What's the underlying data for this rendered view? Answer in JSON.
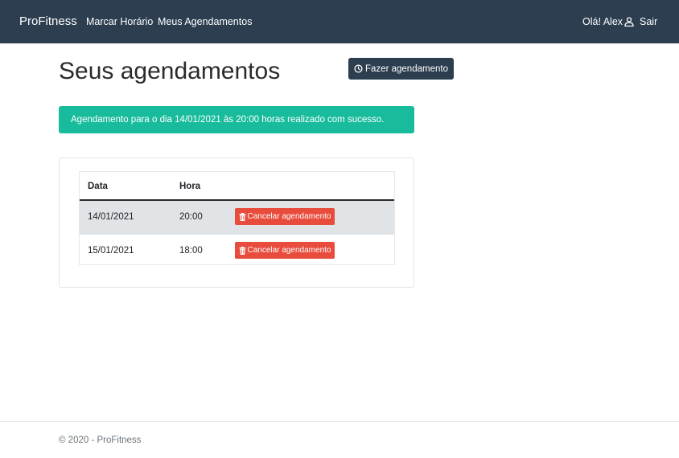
{
  "navbar": {
    "brand": "ProFitness",
    "links": [
      "Marcar Horário",
      "Meus Agendamentos"
    ],
    "greeting": "Olá! Alex",
    "logout": "Sair"
  },
  "main": {
    "title": "Seus agendamentos",
    "new_button": "Fazer agendamento",
    "alert": "Agendamento para o dia 14/01/2021 às 20:00 horas realizado com sucesso."
  },
  "table": {
    "headers": [
      "Data",
      "Hora"
    ],
    "rows": [
      {
        "data": "14/01/2021",
        "hora": "20:00",
        "action": "Cancelar agendamento"
      },
      {
        "data": "15/01/2021",
        "hora": "18:00",
        "action": "Cancelar agendamento"
      }
    ]
  },
  "footer": {
    "text": "© 2020 - ProFitness"
  },
  "colors": {
    "navbar": "#2c3e50",
    "success": "#18bc9c",
    "danger": "#e74c3c"
  },
  "icons": {
    "user": "user-icon",
    "clock": "clock-icon",
    "trash": "trash-icon"
  }
}
